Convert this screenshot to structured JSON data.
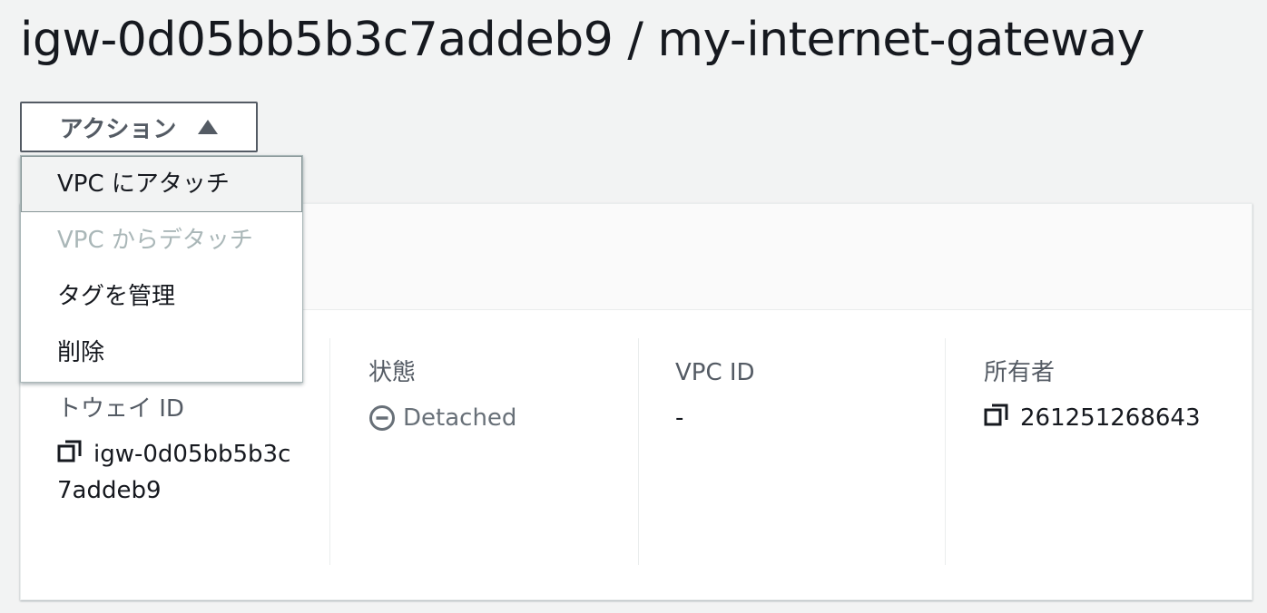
{
  "page": {
    "title": "igw-0d05bb5b3c7addeb9 / my-internet-gateway"
  },
  "actions": {
    "button_label": "アクション",
    "menu_items": [
      {
        "label": "VPC にアタッチ",
        "state": "highlighted"
      },
      {
        "label": "VPC からデタッチ",
        "state": "disabled"
      },
      {
        "label": "タグを管理",
        "state": "enabled"
      },
      {
        "label": "削除",
        "state": "enabled"
      }
    ]
  },
  "details": {
    "gateway_id": {
      "label_visible_part": "トウェイ ID",
      "value": "igw-0d05bb5b3c7addeb9"
    },
    "state": {
      "label": "状態",
      "value": "Detached",
      "icon": "minus-circle-icon"
    },
    "vpc_id": {
      "label": "VPC ID",
      "value": "-"
    },
    "owner": {
      "label": "所有者",
      "value": "261251268643"
    }
  },
  "colors": {
    "page_background": "#f2f3f3",
    "button_border": "#545b64",
    "disabled_text": "#aab7b8",
    "status_text": "#687078"
  }
}
